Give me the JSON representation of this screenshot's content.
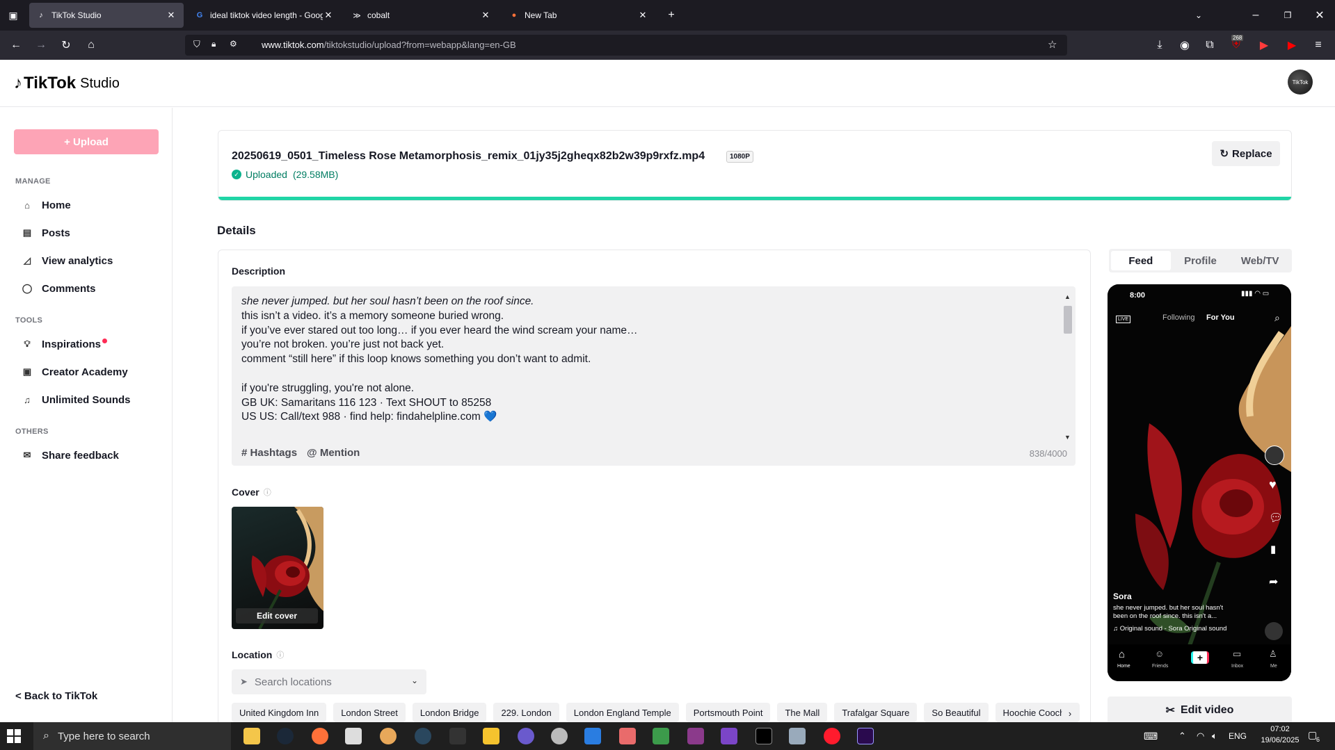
{
  "browser": {
    "tabs": [
      {
        "label": "TikTok Studio",
        "icon": "tiktok-icon",
        "active": true
      },
      {
        "label": "ideal tiktok video length - Goog",
        "icon": "google-icon",
        "active": false
      },
      {
        "label": "cobalt",
        "icon": "cobalt-icon",
        "active": false
      },
      {
        "label": "New Tab",
        "icon": "firefox-icon",
        "active": false
      }
    ],
    "url_domain": "www.tiktok.com",
    "url_path": "/tiktokstudio/upload?from=webapp&lang=en-GB",
    "ext_badge": "268"
  },
  "header": {
    "logo_text": "TikTok",
    "logo_sub": "Studio",
    "avatar_text": "TikTok"
  },
  "sidebar": {
    "upload_label": "+ Upload",
    "manage_label": "MANAGE",
    "tools_label": "TOOLS",
    "others_label": "OTHERS",
    "manage_items": [
      {
        "label": "Home",
        "icon": "home-icon"
      },
      {
        "label": "Posts",
        "icon": "posts-icon"
      },
      {
        "label": "View analytics",
        "icon": "analytics-icon"
      },
      {
        "label": "Comments",
        "icon": "comments-icon"
      }
    ],
    "tools_items": [
      {
        "label": "Inspirations",
        "icon": "bulb-icon"
      },
      {
        "label": "Creator Academy",
        "icon": "academy-icon"
      },
      {
        "label": "Unlimited Sounds",
        "icon": "music-icon"
      }
    ],
    "others_items": [
      {
        "label": "Share feedback",
        "icon": "mail-icon"
      }
    ],
    "back_label": "< Back to TikTok"
  },
  "file": {
    "name": "20250619_0501_Timeless Rose Metamorphosis_remix_01jy35j2gheqx82b2w39p9rxfz.mp4",
    "resolution": "1080P",
    "status": "Uploaded",
    "size": "(29.58MB)",
    "progress": 1.0,
    "replace_label": "Replace"
  },
  "details": {
    "heading": "Details",
    "description_label": "Description",
    "description_lines": [
      "she never jumped. but her soul hasn’t been on the roof since.",
      "this isn’t a video. it’s a memory someone buried wrong.",
      "if you’ve ever stared out too long… if you ever heard the wind scream your name…",
      "you’re not broken. you’re just not back yet.",
      "comment “still here” if this loop knows something you don’t want to admit.",
      "",
      "if you're struggling, you're not alone.",
      "GB UK: Samaritans 116 123 · Text SHOUT to 85258",
      "US US: Call/text 988 · find help: findahelpline.com 💙"
    ],
    "hashtags_label": "# Hashtags",
    "mention_label": "@ Mention",
    "char_count": "838/4000",
    "cover_label": "Cover",
    "edit_cover_label": "Edit cover",
    "location_label": "Location",
    "location_placeholder": "Search locations",
    "location_chips": [
      "United Kingdom Inn",
      "London Street",
      "London Bridge",
      "229. London",
      "London England Temple",
      "Portsmouth Point",
      "The Mall",
      "Trafalgar Square",
      "So Beautiful",
      "Hoochie Coochie"
    ]
  },
  "preview": {
    "tabs": [
      "Feed",
      "Profile",
      "Web/TV"
    ],
    "selected_tab": "Feed",
    "phone_time": "8:00",
    "following": "Following",
    "for_you": "For You",
    "live": "LIVE",
    "username": "Sora",
    "caption": "she never jumped. but her soul hasn't been on the roof since. this isn't a...",
    "sound": "♫ Original sound - Sora   Original sound",
    "nav": [
      "Home",
      "Friends",
      "",
      "Inbox",
      "Me"
    ],
    "edit_video_label": "Edit video"
  },
  "taskbar": {
    "search_placeholder": "Type here to search",
    "lang": "ENG",
    "time": "07:02",
    "date": "19/06/2025",
    "notif_count": "6"
  },
  "colors": {
    "accent": "#fe2c55",
    "upload_btn": "#fda4b6",
    "progress": "#20d5a6",
    "success": "#017d62"
  }
}
